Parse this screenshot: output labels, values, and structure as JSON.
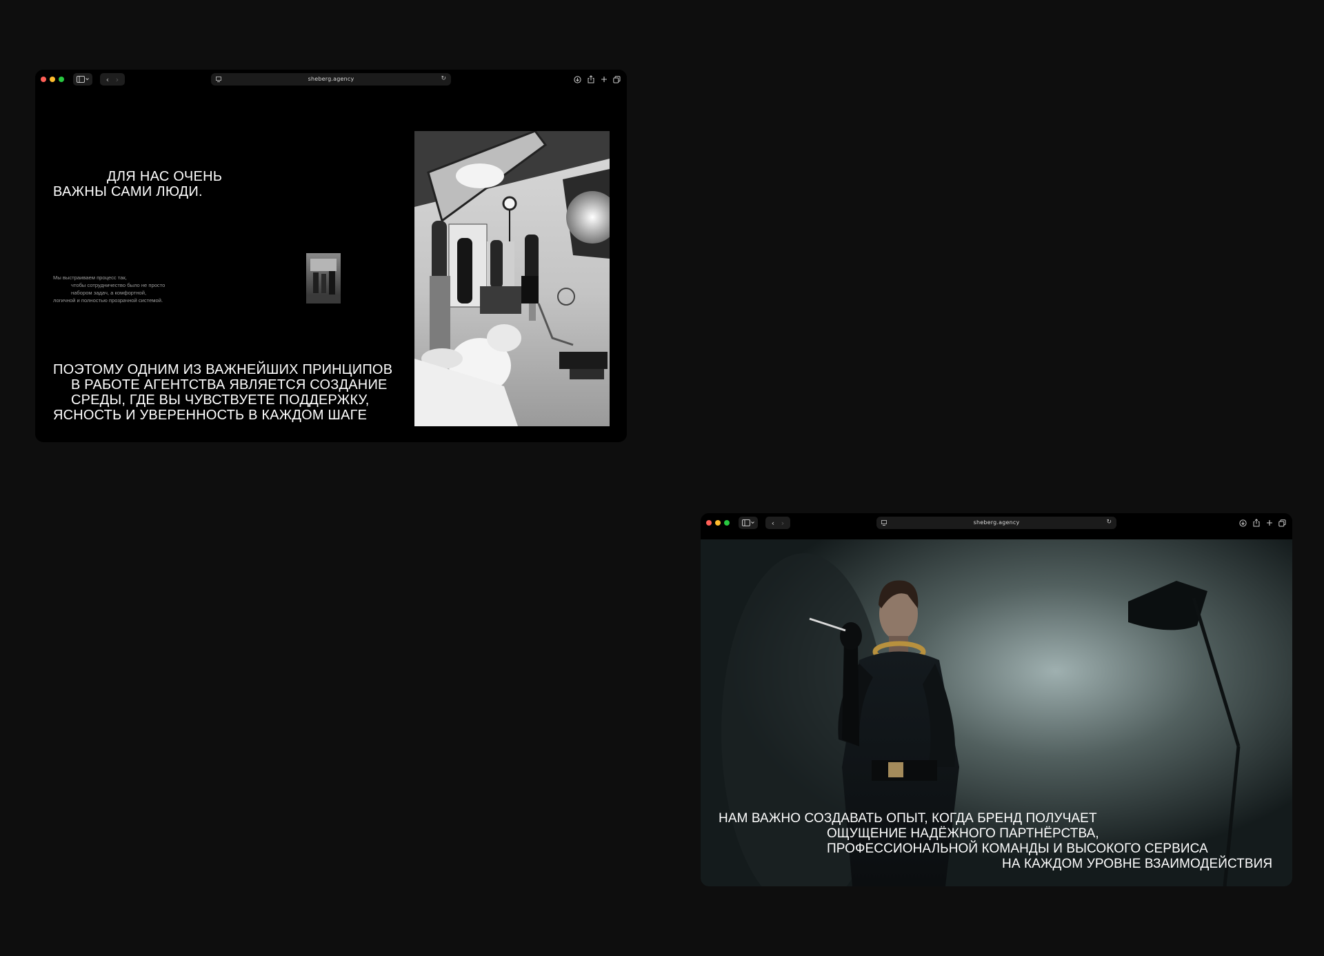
{
  "window_top": {
    "url": "sheberg.agency",
    "heading_small": {
      "line1": "ДЛЯ НАС ОЧЕНЬ",
      "line2": "ВАЖНЫ САМИ ЛЮДИ."
    },
    "body_text": {
      "line1": "Мы выстраиваем процесс так,",
      "line2": "чтобы сотрудничество было не просто",
      "line3": "набором задач, а комфортной,",
      "line4": "логичной и полностью прозрачной системой."
    },
    "heading_large": {
      "line1": "ПОЭТОМУ ОДНИМ ИЗ ВАЖНЕЙШИХ ПРИНЦИПОВ",
      "line2": "В РАБОТЕ АГЕНТСТВА ЯВЛЯЕТСЯ СОЗДАНИЕ",
      "line3": "СРЕДЫ, ГДЕ ВЫ ЧУВСТВУЕТЕ ПОДДЕРЖКУ,",
      "line4": "ЯСНОСТЬ И УВЕРЕННОСТЬ В КАЖДОМ ШАГЕ"
    }
  },
  "window_bottom": {
    "url": "sheberg.agency",
    "hero_text": {
      "line1": "НАМ ВАЖНО СОЗДАВАТЬ ОПЫТ, КОГДА БРЕНД ПОЛУЧАЕТ",
      "line2": "ОЩУЩЕНИЕ НАДЁЖНОГО ПАРТНЁРСТВА,",
      "line3": "ПРОФЕССИОНАЛЬНОЙ КОМАНДЫ И ВЫСОКОГО СЕРВИСА",
      "line4": "НА КАЖДОМ УРОВНЕ ВЗАИМОДЕЙСТВИЯ"
    }
  },
  "icons": {
    "close": "close-dot",
    "minimize": "minimize-dot",
    "zoom": "zoom-dot",
    "sidebar": "sidebar-icon",
    "back": "chevron-left-icon",
    "forward": "chevron-right-icon",
    "reload": "reload-icon",
    "download": "download-icon",
    "share": "share-icon",
    "new_tab": "plus-icon",
    "tabs": "tabs-overview-icon"
  },
  "colors": {
    "background": "#0e0e0e",
    "window": "#000000",
    "close": "#ff5f57",
    "minimize": "#febc2e",
    "zoom": "#28c840"
  }
}
